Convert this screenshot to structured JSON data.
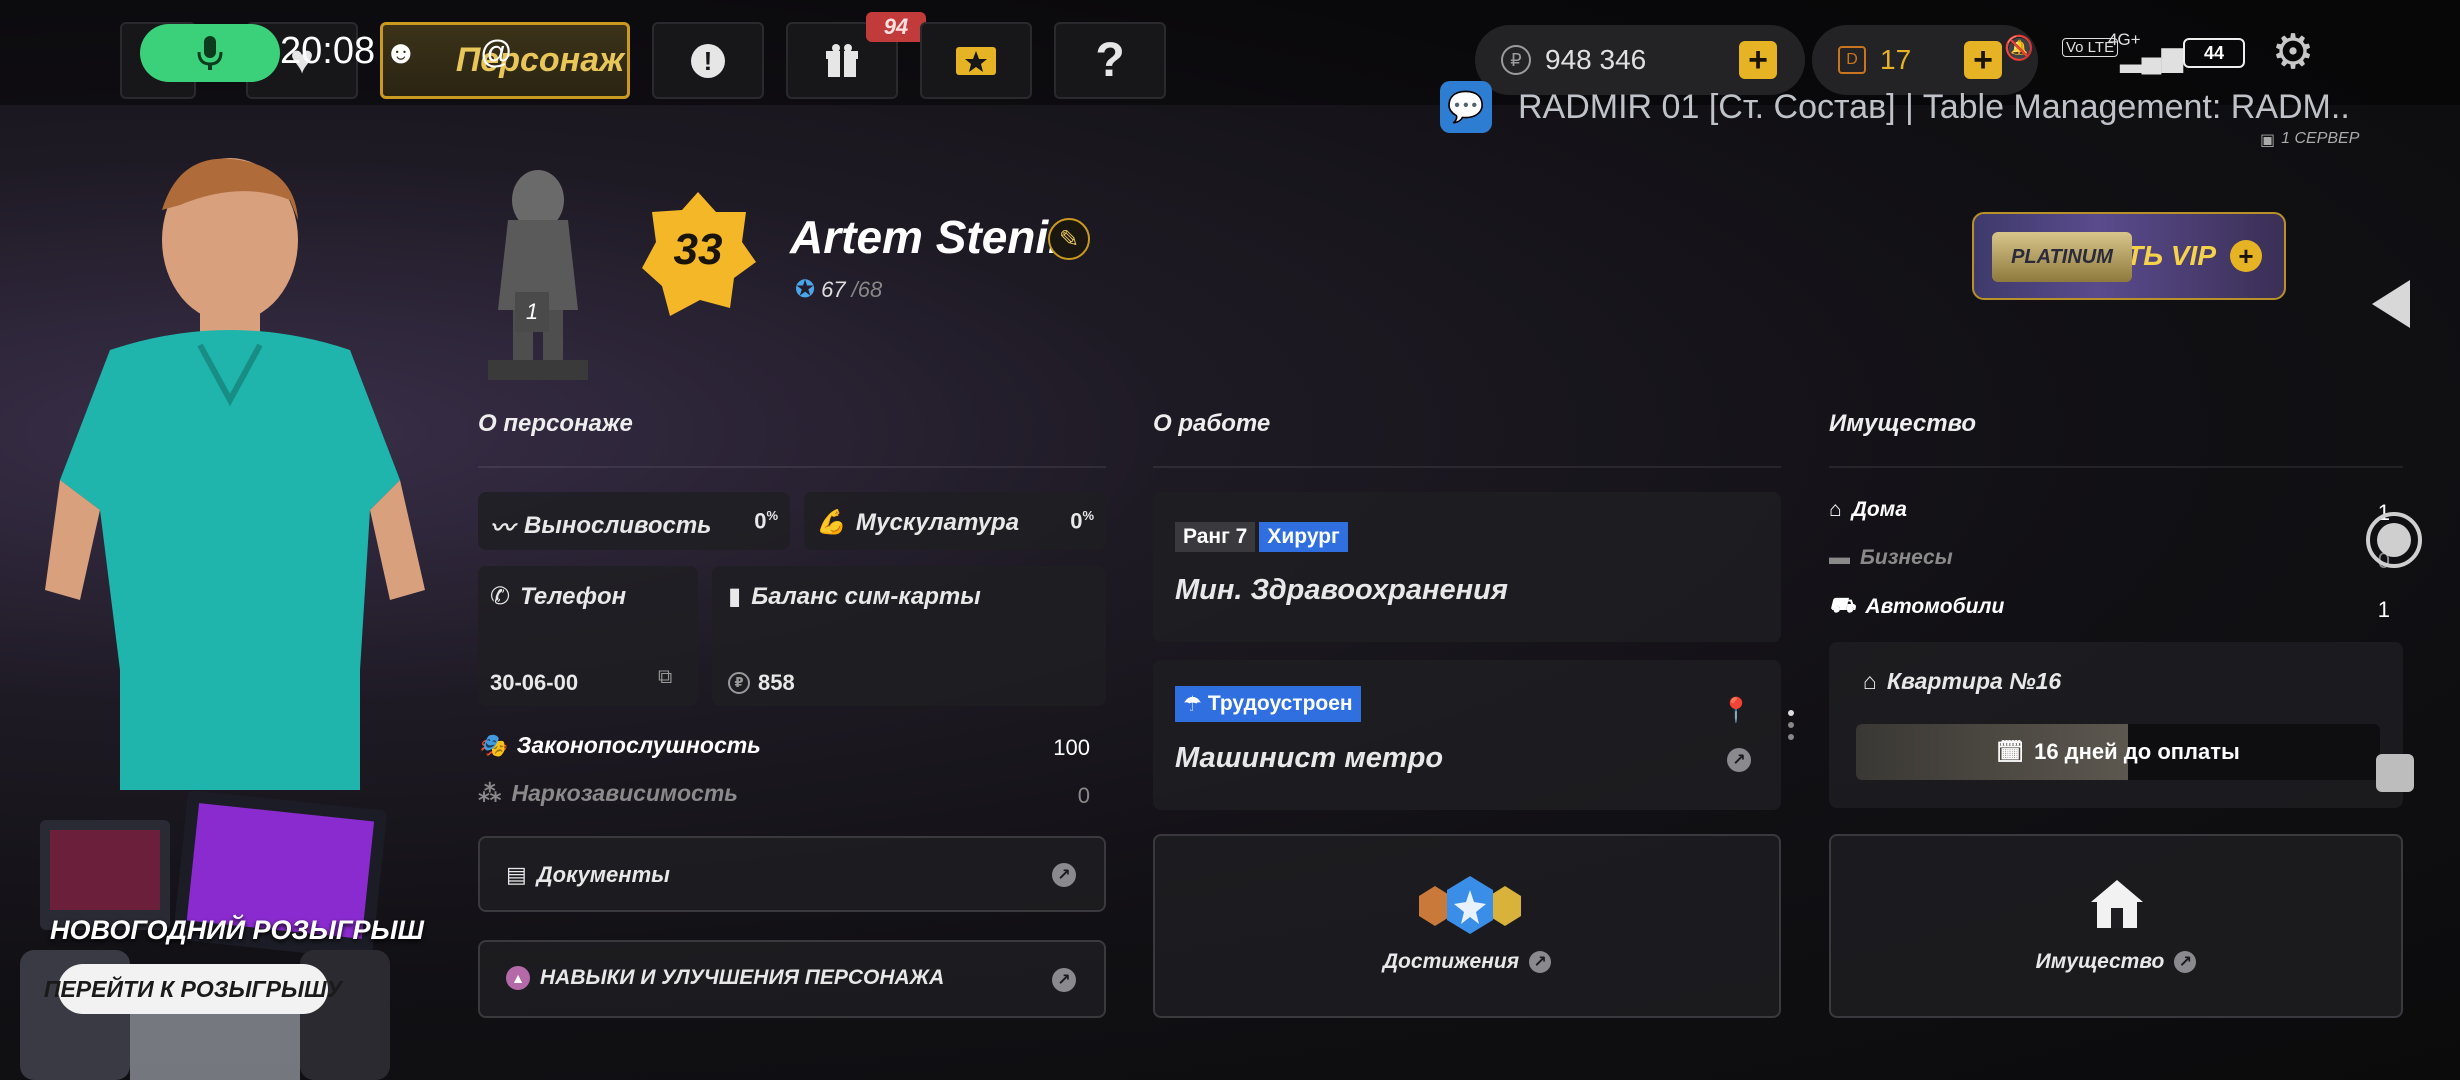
{
  "status_bar": {
    "time": "20:08",
    "network": "4G+",
    "volte": "Vo LTE",
    "battery": "44"
  },
  "top_nav": {
    "active_tab": "Персонаж",
    "gifts_badge": "94",
    "alert_icon": "alert-icon",
    "gift_icon": "gift-icon",
    "star_icon": "star-card-icon",
    "help_label": "?"
  },
  "currencies": {
    "money": "948 346",
    "donate": "17"
  },
  "notification": {
    "text": "RADMIR 01 [Ст. Состав] | Table Management: RADM..",
    "server": "1 СЕРВЕР"
  },
  "character": {
    "name": "Artem Stenin",
    "level": "33",
    "exp_current": "67",
    "exp_max": "/68",
    "statue_rank": "1"
  },
  "vip": {
    "badge": "PLATINUM",
    "label": "СТАТЬ VIP"
  },
  "giveaway": {
    "title": "НОВОГОДНИЙ РОЗЫГРЫШ",
    "button": "ПЕРЕЙТИ К РОЗЫГРЫШУ"
  },
  "about": {
    "title": "О персонаже",
    "endurance_label": "Выносливость",
    "endurance_value": "0",
    "muscles_label": "Мускулатура",
    "muscles_value": "0",
    "percent": "%",
    "phone_label": "Телефон",
    "phone_value": "30-06-00",
    "sim_label": "Баланс сим-карты",
    "sim_value": "858",
    "law_label": "Законопослушность",
    "law_value": "100",
    "drug_label": "Наркозависимость",
    "drug_value": "0",
    "documents": "Документы",
    "skills": "НАВЫКИ И УЛУЧШЕНИЯ ПЕРСОНАЖА"
  },
  "work": {
    "title": "О работе",
    "rank": "Ранг 7",
    "position": "Хирург",
    "organization": "Мин. Здравоохранения",
    "employed_tag": "Трудоустроен",
    "job": "Машинист метро",
    "achievements": "Достижения"
  },
  "property": {
    "title": "Имущество",
    "houses_label": "Дома",
    "houses_value": "1",
    "business_label": "Бизнесы",
    "business_value": "0",
    "cars_label": "Автомобили",
    "cars_value": "1",
    "apartment": "Квартира №16",
    "payment": "16 дней до оплаты",
    "payment_fill": 0.52,
    "property_button": "Имущество"
  },
  "colors": {
    "accent_gold": "#e6b325",
    "blue_tag": "#2f6fe0",
    "mic_green": "#3ad17a",
    "badge_red": "#c23b3b"
  }
}
